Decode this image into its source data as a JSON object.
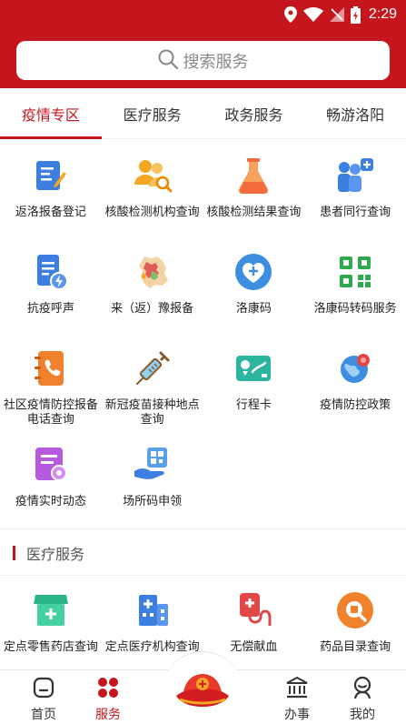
{
  "status": {
    "time": "2:29"
  },
  "search": {
    "placeholder": "搜索服务"
  },
  "tabs": [
    {
      "label": "疫情专区",
      "active": true
    },
    {
      "label": "医疗服务",
      "active": false
    },
    {
      "label": "政务服务",
      "active": false
    },
    {
      "label": "畅游洛阳",
      "active": false
    }
  ],
  "epidemic": {
    "items": [
      {
        "label": "返洛报备登记",
        "icon": "edit-document-icon"
      },
      {
        "label": "核酸检测机构查询",
        "icon": "users-search-icon"
      },
      {
        "label": "核酸检测结果查询",
        "icon": "flask-icon"
      },
      {
        "label": "患者同行查询",
        "icon": "people-plus-icon"
      },
      {
        "label": "抗疫呼声",
        "icon": "document-bolt-icon"
      },
      {
        "label": "来（返）豫报备",
        "icon": "henan-map-icon"
      },
      {
        "label": "洛康码",
        "icon": "heart-plus-icon"
      },
      {
        "label": "洛康码转码服务",
        "icon": "qr-code-icon"
      },
      {
        "label": "社区疫情防控报备电话查询",
        "icon": "phone-book-icon"
      },
      {
        "label": "新冠疫苗接种地点查询",
        "icon": "syringe-icon"
      },
      {
        "label": "行程卡",
        "icon": "itinerary-card-icon"
      },
      {
        "label": "疫情防控政策",
        "icon": "virus-globe-icon"
      },
      {
        "label": "疫情实时动态",
        "icon": "news-virus-icon"
      },
      {
        "label": "场所码申领",
        "icon": "hand-qr-icon"
      }
    ]
  },
  "medical_section": {
    "title": "医疗服务",
    "items": [
      {
        "label": "定点零售药店查询",
        "icon": "pharmacy-store-icon"
      },
      {
        "label": "定点医疗机构查询",
        "icon": "hospital-icon"
      },
      {
        "label": "无偿献血",
        "icon": "blood-bag-icon"
      },
      {
        "label": "药品目录查询",
        "icon": "medicine-search-icon"
      }
    ]
  },
  "nav": {
    "home": "首页",
    "services": "服务",
    "affairs": "办事",
    "mine": "我的",
    "center_icon": "city-logo-icon"
  },
  "colors": {
    "brand": "#c4161c"
  }
}
